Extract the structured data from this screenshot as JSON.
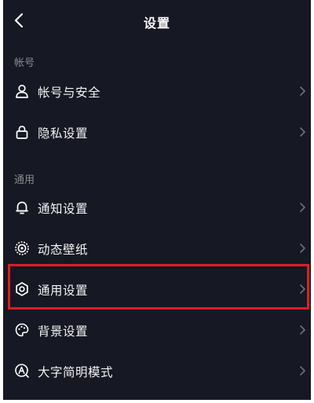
{
  "header": {
    "title": "设置"
  },
  "sections": [
    {
      "label": "帐号",
      "items": [
        {
          "label": "帐号与安全",
          "icon": "user-icon"
        },
        {
          "label": "隐私设置",
          "icon": "lock-icon"
        }
      ]
    },
    {
      "label": "通用",
      "items": [
        {
          "label": "通知设置",
          "icon": "bell-icon"
        },
        {
          "label": "动态壁纸",
          "icon": "live-wallpaper-icon"
        },
        {
          "label": "通用设置",
          "icon": "gear-icon",
          "highlighted": true
        },
        {
          "label": "背景设置",
          "icon": "palette-icon"
        },
        {
          "label": "大字简明模式",
          "icon": "font-mode-icon"
        }
      ]
    }
  ],
  "colors": {
    "background": "#161823",
    "text": "#f2f2f3",
    "section_label": "#8a8b91",
    "chevron": "#6e6f76",
    "highlight_border": "#e31b23"
  }
}
